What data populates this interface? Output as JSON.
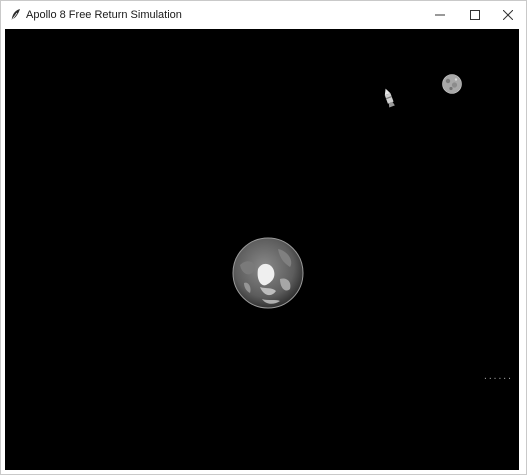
{
  "window": {
    "title": "Apollo 8 Free Return Simulation",
    "icons": {
      "app": "feather-icon",
      "minimize": "minimize-icon",
      "maximize": "maximize-icon",
      "close": "close-icon"
    }
  },
  "scene": {
    "background": "#000000",
    "bodies": [
      "earth",
      "moon",
      "command-service-module"
    ],
    "corner_label": "......"
  },
  "colors": {
    "titlebar": "#ffffff",
    "title_text": "#1a1a1a",
    "space": "#000000",
    "earth_ocean": "#6b6b6b",
    "earth_land": "#ebebeb",
    "moon": "#b8b8b8"
  }
}
